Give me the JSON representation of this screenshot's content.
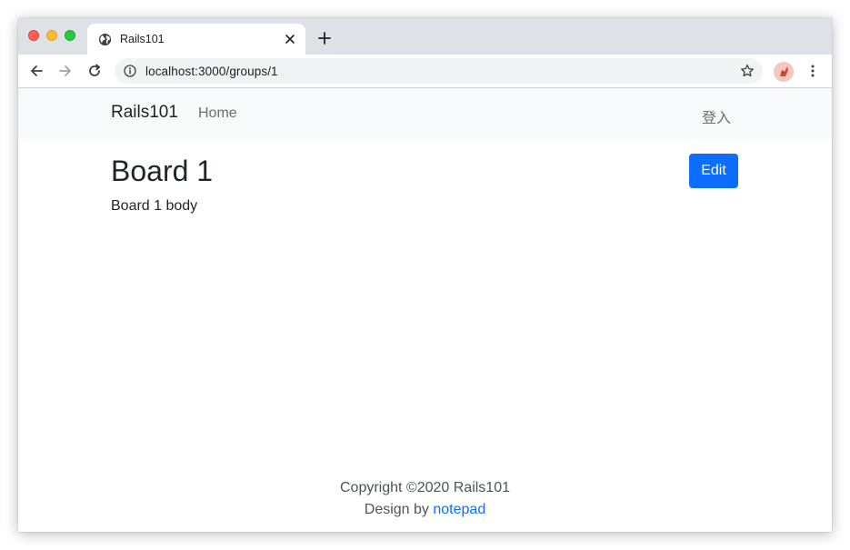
{
  "browser": {
    "tab": {
      "title": "Rails101",
      "favicon": "globe-icon"
    },
    "address_bar": {
      "url": "localhost:3000/groups/1"
    },
    "icons": {
      "back": "arrow-left-icon",
      "forward": "arrow-right-icon",
      "reload": "reload-icon",
      "info": "info-icon",
      "bookmark": "star-icon",
      "menu": "more-vertical-icon",
      "new_tab": "plus-icon",
      "close_tab": "close-icon"
    },
    "colors": {
      "tab_strip": "#dee1e6",
      "omnibox": "#f1f3f4"
    }
  },
  "navbar": {
    "brand": "Rails101",
    "home": "Home",
    "login": "登入"
  },
  "main": {
    "title": "Board 1",
    "body": "Board 1 body",
    "edit_label": "Edit"
  },
  "footer": {
    "copyright": "Copyright ©2020 Rails101",
    "design_prefix": "Design by",
    "design_link": "notepad"
  },
  "colors": {
    "primary": "#0d6efd",
    "navbar_bg": "#f8f9fa",
    "text": "#212529"
  }
}
